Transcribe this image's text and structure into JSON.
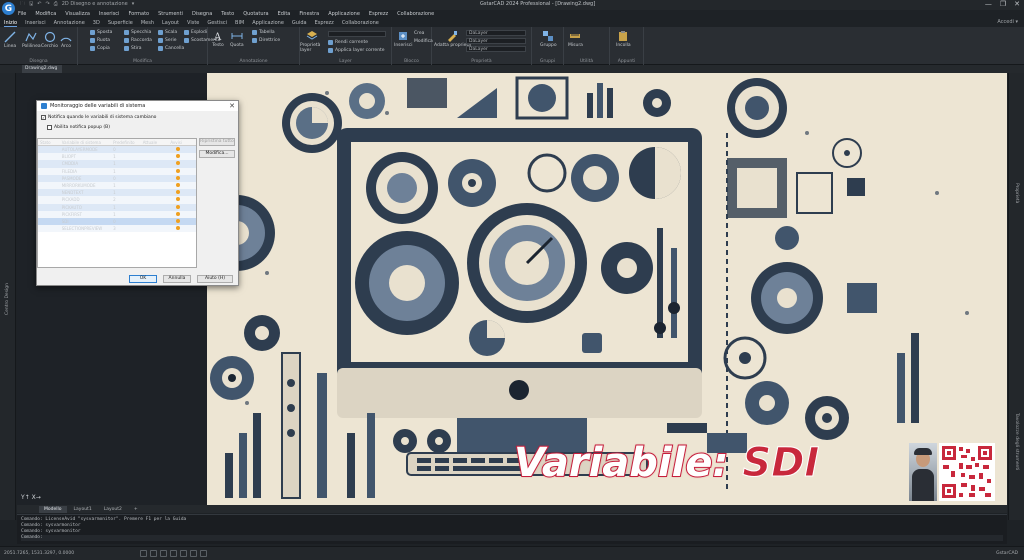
{
  "window": {
    "title": "GstarCAD 2024 Professional - [Drawing2.dwg]",
    "controls": [
      "—",
      "❐",
      "✕"
    ]
  },
  "qat_items": [
    "🗀",
    "🖫",
    "↶",
    "↷",
    "⎙",
    "2D Disegno e annotazione",
    "▾"
  ],
  "menu": [
    "File",
    "Modifica",
    "Visualizza",
    "Inserisci",
    "Formato",
    "Strumenti",
    "Disegna",
    "Testo",
    "Quotatura",
    "Edita",
    "Finestra",
    "Applicazione",
    "Esprezz",
    "Collaborazione"
  ],
  "ribbon_tabs": [
    "Inizio",
    "Inserisci",
    "Annotazione",
    "3D",
    "Superficie",
    "Mesh",
    "Layout",
    "Viste",
    "Gestisci",
    "BIM",
    "Applicazione",
    "Guida",
    "Esprezz",
    "Collaborazione"
  ],
  "active_ribbon_tab": "Inizio",
  "user_area": "Accedi ▾",
  "ribbon": {
    "draw_tools": [
      "Linea",
      "Polilinea",
      "Cerchio",
      "Arco"
    ],
    "modify_small": [
      "Sposta",
      "Ruota",
      "Copia",
      "Specchia",
      "Raccorda",
      "Stira",
      "Scala",
      "Serie",
      "Cancella",
      "Esplodi",
      "Scostamento"
    ],
    "annotation_tools": [
      "Testo",
      "Quota",
      "Tabella",
      "Direttrice"
    ],
    "layer_tools": [
      "Proprietà layer",
      "Rendi corrente",
      "Applica layer corrente"
    ],
    "block_tools": [
      "Inserisci",
      "Crea",
      "Modifica"
    ],
    "properties_tools": [
      "Adatta proprietà",
      "DaLayer",
      "DaLayer",
      "DaLayer"
    ],
    "groups_tools": [
      "Gruppo"
    ],
    "utility_tools": [
      "Misura"
    ],
    "clipboard_tools": [
      "Incolla"
    ],
    "group_labels": [
      "Disegna",
      "Modifica",
      "Annotazione",
      "Layer",
      "Blocco",
      "Proprietà",
      "Gruppi",
      "Utilità",
      "Appunti"
    ]
  },
  "document_tab": "Drawing2.dwg",
  "side_panels": {
    "left": "Centro Design",
    "right_top": "Proprietà",
    "right_bottom": "Tavolozze degli strumenti"
  },
  "dialog": {
    "title": "Monitoraggio delle variabili di sistema",
    "notify_checkbox": "Notifica quando le variabili di sistema cambiano",
    "popup_checkbox": "Abilita notifica popup (B)",
    "columns": [
      "Stato",
      "Variabile di sistema",
      "Predefinito",
      "Attuale",
      "Avvisi"
    ],
    "variables": [
      "AUTOLAYERMODE",
      "BLIOPT",
      "CMDDIA",
      "FILEDIA",
      "PASMODE",
      "MIRRORKUMODE",
      "NENDTEXT",
      "PICKADD",
      "PICKAUTO",
      "PICKFIRST",
      "SDI",
      "SELECTIONPREVIEW"
    ],
    "defaults": [
      "0",
      "1",
      "1",
      "1",
      "0",
      "1",
      "1",
      "2",
      "1",
      "1",
      "0",
      "3"
    ],
    "button_apply": "Ripristina tutto",
    "button_modify": "Modifica...",
    "button_ok": "OK",
    "button_cancel": "Annulla",
    "button_help": "Aiuto (H)",
    "close_glyph": "✕"
  },
  "layout_tabs": [
    "Modello",
    "Layout1",
    "Layout2",
    "+"
  ],
  "command_lines": [
    "Comando: LicenseAvid \"sysvarmonitor\". Premere F1 per la Guida",
    "Comando: sysvarmonitor",
    "Comando: sysvarmonitor",
    "Comando:"
  ],
  "status": {
    "coords": "2051.7265, 1531.3297, 0.0000",
    "right_text": "GstarCAD"
  },
  "overlay": {
    "word": "Variabile:",
    "value": "SDI"
  },
  "colors": {
    "accent": "#2d7fd0",
    "overlay_red": "#c8283c",
    "warning_dot": "#f0a020"
  }
}
